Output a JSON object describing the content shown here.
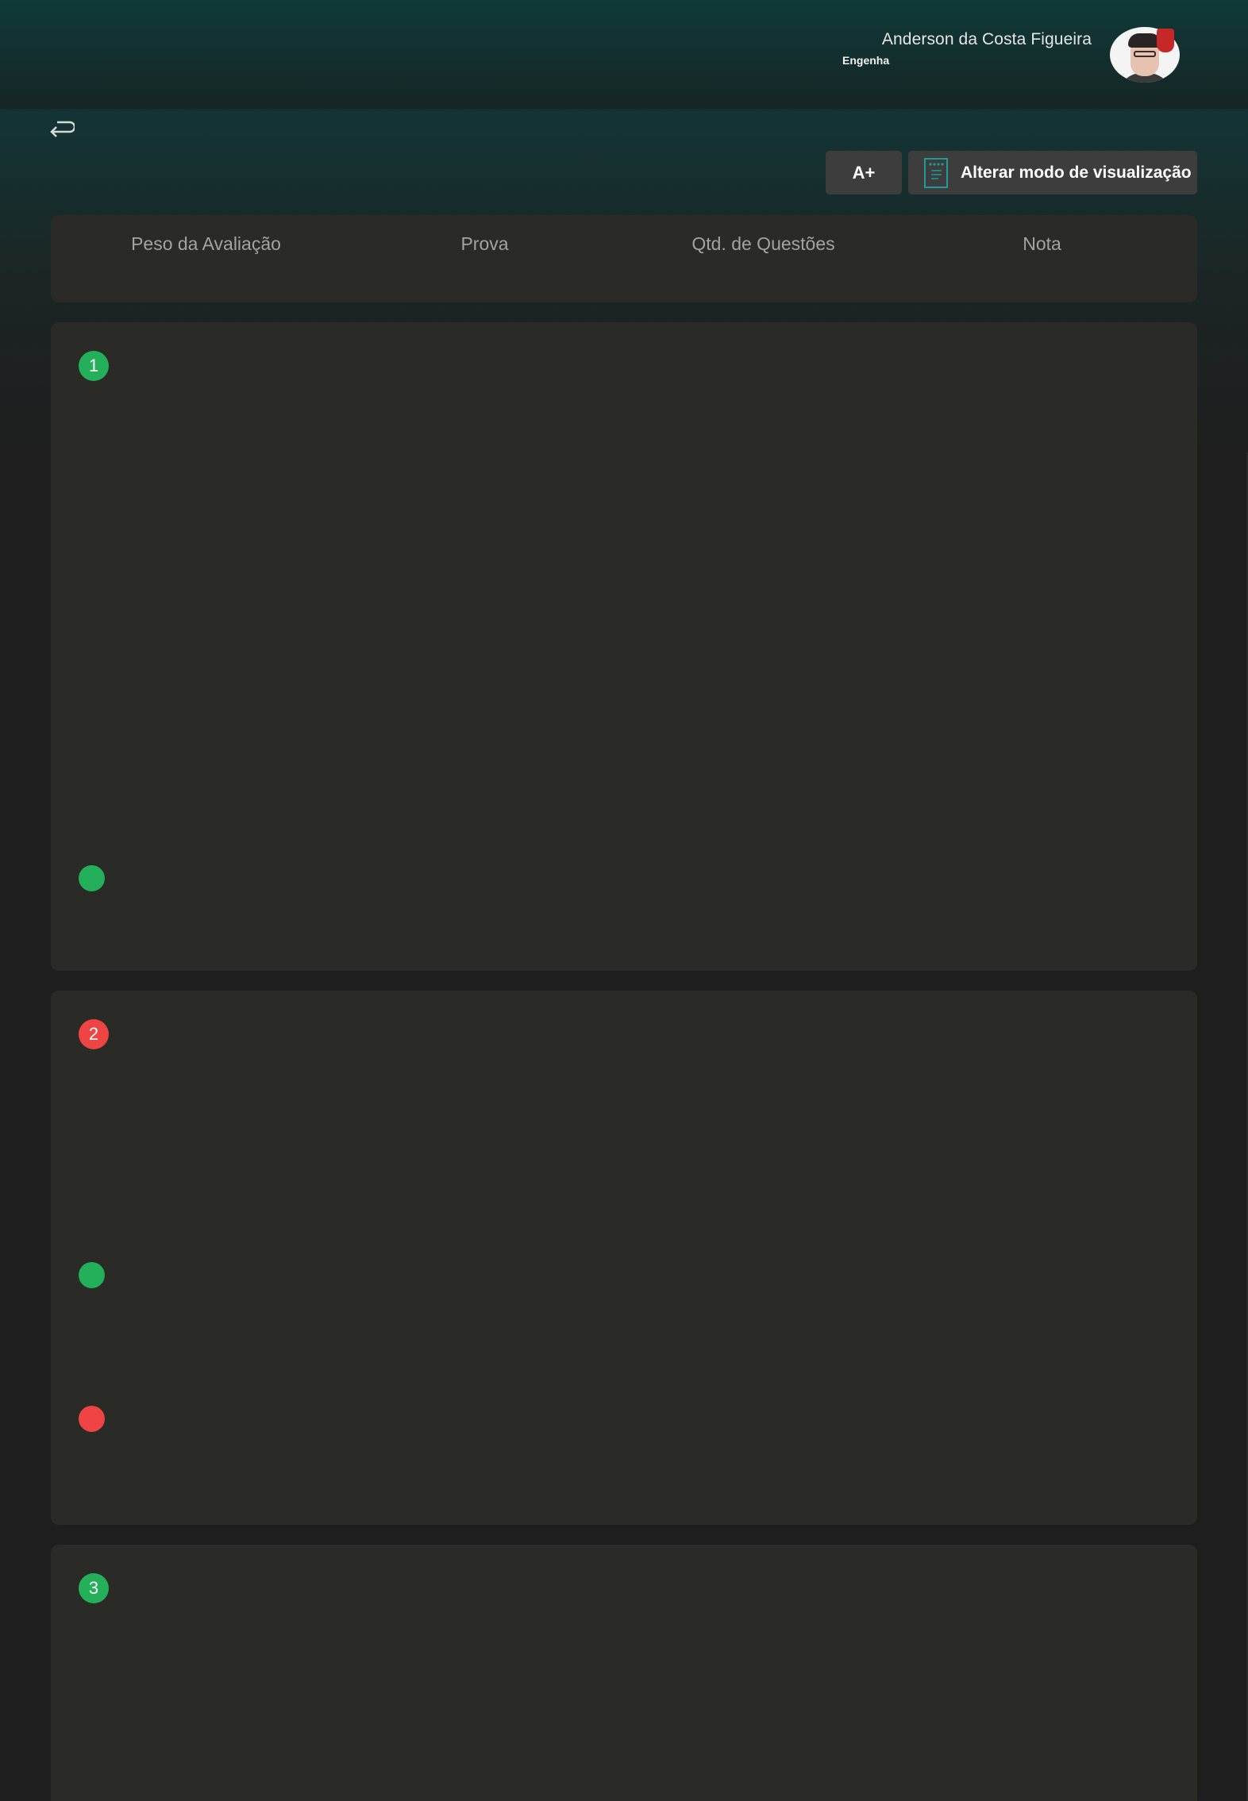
{
  "header": {
    "user_name": "Anderson da Costa Figueira",
    "user_subtitle": "Engenha"
  },
  "toolbar": {
    "font_size_label": "A+",
    "view_mode_label": "Alterar modo de visualização"
  },
  "summary": {
    "columns": [
      "Peso da Avaliação",
      "Prova",
      "Qtd. de Questões",
      "Nota"
    ]
  },
  "questions": [
    {
      "number": "1",
      "status": "correct"
    },
    {
      "number": "2",
      "status": "incorrect"
    },
    {
      "number": "3",
      "status": "correct"
    }
  ],
  "colors": {
    "correct": "#24b05a",
    "incorrect": "#ee4444",
    "panel": "#2a2a27",
    "header": "#0f3a38"
  }
}
